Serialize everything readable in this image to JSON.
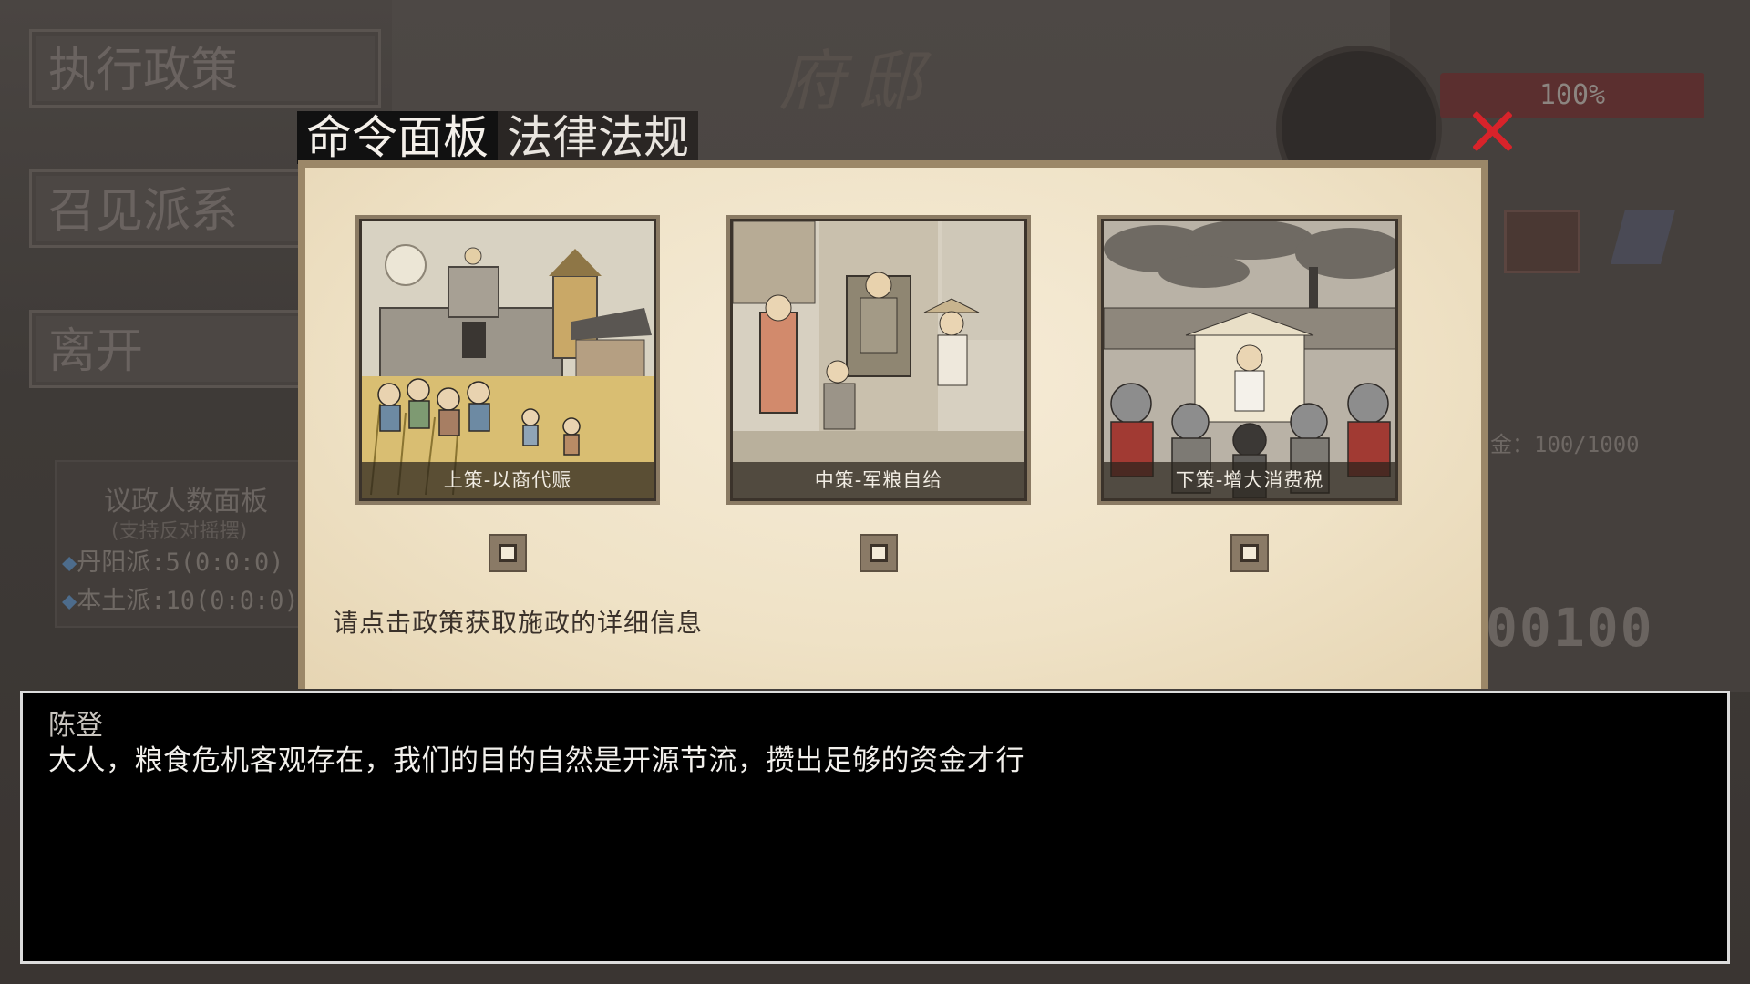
{
  "background": {
    "hall_title": "府邸",
    "hp_percent": "100%",
    "gold_readout": "金：100/1000",
    "counter": "00100",
    "menu": [
      "执行政策",
      "召见派系",
      "离开"
    ],
    "council": {
      "title": "议政人数面板",
      "subtitle": "(支持反对摇摆)",
      "rows": [
        "丹阳派:5(0:0:0)",
        "本土派:10(0:0:0)"
      ]
    }
  },
  "modal": {
    "tabs": [
      {
        "label": "命令面板",
        "active": true
      },
      {
        "label": "法律法规",
        "active": false
      }
    ],
    "policies": [
      {
        "caption": "上策-以商代赈",
        "icon": "city-grain-scene-illustration",
        "checked": false
      },
      {
        "caption": "中策-军粮自给",
        "icon": "court-officials-scene-illustration",
        "checked": false
      },
      {
        "caption": "下策-增大消费税",
        "icon": "army-gathering-scene-illustration",
        "checked": false
      }
    ],
    "hint": "请点击政策获取施政的详细信息",
    "close_color": "#d8232a"
  },
  "dialog": {
    "speaker": "陈登",
    "text": "大人，粮食危机客观存在，我们的目的自然是开源节流，攒出足够的资金才行"
  }
}
